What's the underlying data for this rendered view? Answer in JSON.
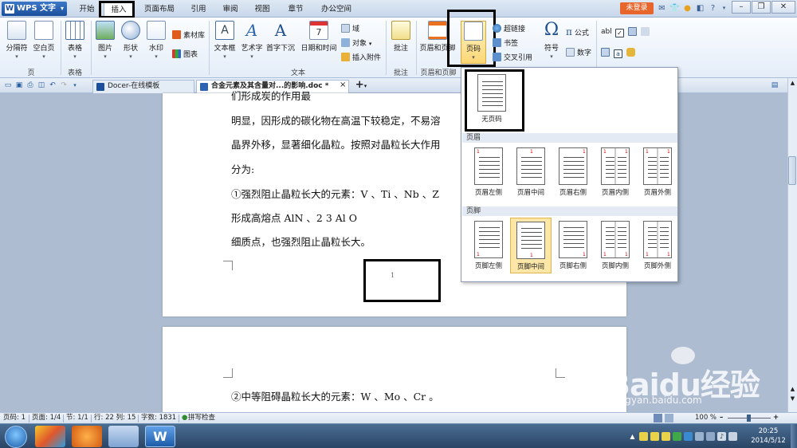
{
  "title_bar": {
    "app_name": "WPS 文字",
    "tabs": [
      "开始",
      "插入",
      "页面布局",
      "引用",
      "审阅",
      "视图",
      "章节",
      "办公空间"
    ],
    "active_tab": "插入",
    "login_label": "未登录"
  },
  "ribbon": {
    "groups": {
      "page": "页",
      "table": "表格",
      "text": "文本",
      "comment": "批注",
      "header_footer": "页眉和页脚",
      "symbol": "符号"
    },
    "buttons": {
      "section_break": "分隔符",
      "blank_page": "空白页",
      "table": "表格",
      "picture": "图片",
      "shape": "形状",
      "watermark": "水印",
      "material": "素材库",
      "chart": "图表",
      "textbox": "文本框",
      "wordart": "艺术字",
      "dropcap": "首字下沉",
      "datetime": "日期和时间",
      "field": "域",
      "object": "对象",
      "attachment": "插入附件",
      "comment": "批注",
      "header_footer": "页眉和页脚",
      "page_number": "页码",
      "hyperlink": "超链接",
      "bookmark": "书签",
      "crossref": "交叉引用",
      "symbol": "符号",
      "formula": "公式",
      "number": "数字",
      "abl": "abl"
    }
  },
  "doc_tabs": {
    "docer": "Docer-在线模板",
    "current": "合金元素及其含量对...的影响.doc *",
    "close": "×",
    "add": "+"
  },
  "document": {
    "page1_lines": [
      "们形成炭的作用最",
      "明显，因形成的碳化物在高温下较稳定，不易溶",
      "晶界外移，显著细化晶粒。按照对晶粒长大作用",
      "分为:",
      "①强烈阻止晶粒长大的元素：V 、Ti 、Nb 、Z",
      "形成高熔点 AlN 、2 3 Al O",
      "细质点，也强烈阻止晶粒长大。"
    ],
    "page_number_footer": "1",
    "page2_lines": [
      "②中等阻碍晶粒长大的元素：W 、Mo 、Cr 。"
    ]
  },
  "dropdown": {
    "no_page_number": "无页码",
    "header_section": "页眉",
    "footer_section": "页脚",
    "header_options": [
      "页眉左侧",
      "页眉中间",
      "页眉右侧",
      "页眉内侧",
      "页眉外侧"
    ],
    "footer_options": [
      "页脚左侧",
      "页脚中间",
      "页脚右侧",
      "页脚内侧",
      "页脚外侧"
    ],
    "selected": "页脚中间",
    "sample_number": "1"
  },
  "status_bar": {
    "page_num": "页码: 1",
    "pages": "页面: 1/4",
    "section": "节: 1/1",
    "row_col": "行: 22  列: 15",
    "words": "字数: 1831",
    "spell": "拼写检查",
    "zoom": "100 %"
  },
  "taskbar": {
    "time": "20:25",
    "date": "2014/5/12"
  },
  "watermark": {
    "brand": "Baidu经验",
    "url": "jingyan.baidu.com"
  },
  "colors": {
    "accent_blue": "#1b4f9c",
    "login_orange": "#e8652c",
    "page_number_red": "#cc0000",
    "selected_option": "#fde7a8"
  }
}
